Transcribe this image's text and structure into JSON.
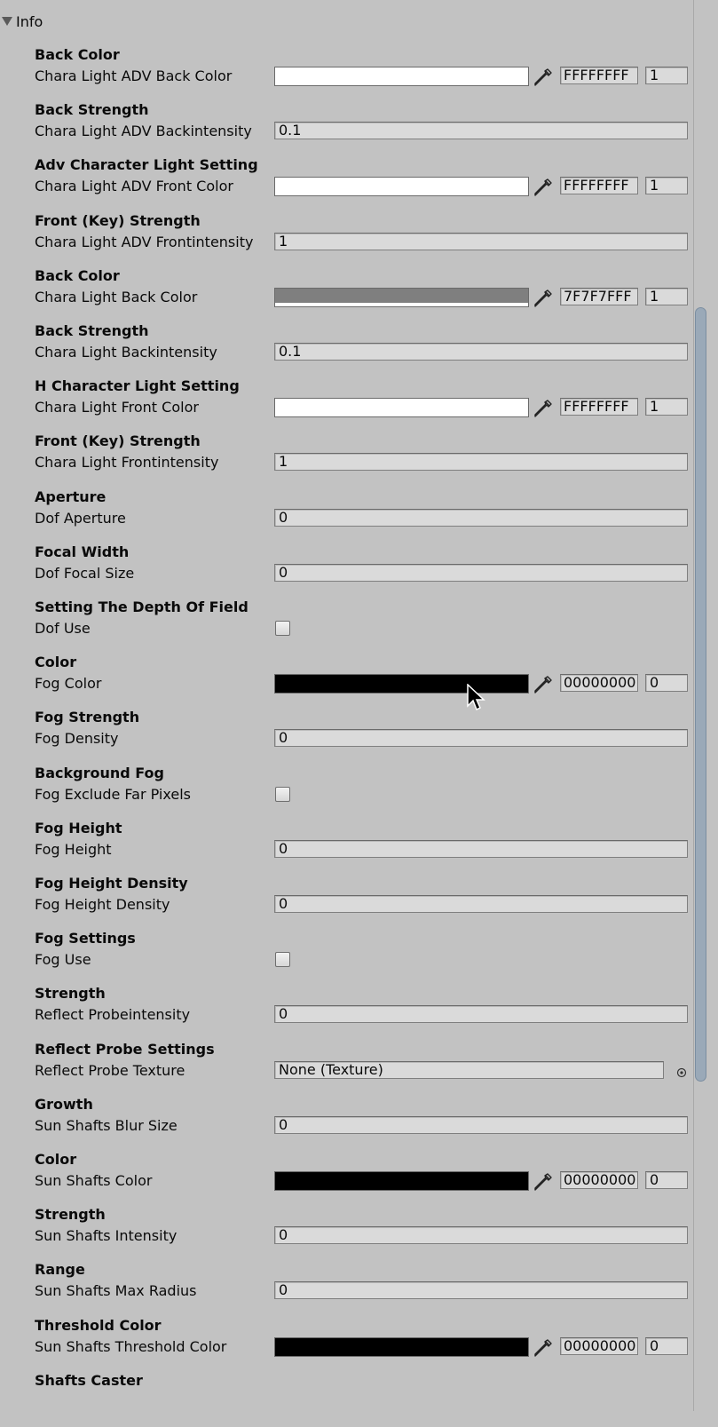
{
  "foldout": {
    "label": "Info"
  },
  "colors": {
    "background": "#c2c2c2",
    "field": "#dadada",
    "scrollbar": "#9aa9b8"
  },
  "properties": [
    {
      "header": "Back Color",
      "name": "Chara Light ADV Back Color",
      "type": "color",
      "swatch": "#ffffff",
      "alpha_bar": true,
      "hex": "FFFFFFFF",
      "alpha": "1"
    },
    {
      "header": "Back Strength",
      "name": "Chara Light ADV Backintensity",
      "type": "text",
      "value": "0.1"
    },
    {
      "header": "Adv Character Light Setting",
      "name": "Chara Light ADV Front Color",
      "type": "color",
      "swatch": "#ffffff",
      "alpha_bar": true,
      "hex": "FFFFFFFF",
      "alpha": "1"
    },
    {
      "header": "Front (Key) Strength",
      "name": "Chara Light ADV Frontintensity",
      "type": "text",
      "value": "1"
    },
    {
      "header": "Back Color",
      "name": "Chara Light Back Color",
      "type": "color",
      "swatch": "#7f7f7f",
      "alpha_bar": true,
      "hex": "7F7F7FFF",
      "alpha": "1"
    },
    {
      "header": "Back Strength",
      "name": "Chara Light Backintensity",
      "type": "text",
      "value": "0.1"
    },
    {
      "header": "H Character Light Setting",
      "name": "Chara Light Front Color",
      "type": "color",
      "swatch": "#ffffff",
      "alpha_bar": true,
      "hex": "FFFFFFFF",
      "alpha": "1"
    },
    {
      "header": "Front (Key) Strength",
      "name": "Chara Light Frontintensity",
      "type": "text",
      "value": "1"
    },
    {
      "header": "Aperture",
      "name": "Dof Aperture",
      "type": "text",
      "value": "0"
    },
    {
      "header": "Focal Width",
      "name": "Dof Focal Size",
      "type": "text",
      "value": "0"
    },
    {
      "header": "Setting The Depth Of Field",
      "name": "Dof Use",
      "type": "checkbox",
      "checked": false
    },
    {
      "header": "Color",
      "name": "Fog Color",
      "type": "color",
      "swatch": "#000000",
      "alpha_bar": false,
      "hex": "00000000",
      "alpha": "0"
    },
    {
      "header": "Fog Strength",
      "name": "Fog Density",
      "type": "text",
      "value": "0"
    },
    {
      "header": "Background Fog",
      "name": "Fog Exclude Far Pixels",
      "type": "checkbox",
      "checked": false
    },
    {
      "header": "Fog Height",
      "name": "Fog Height",
      "type": "text",
      "value": "0"
    },
    {
      "header": "Fog Height Density",
      "name": "Fog Height Density",
      "type": "text",
      "value": "0"
    },
    {
      "header": "Fog Settings",
      "name": "Fog Use",
      "type": "checkbox",
      "checked": false
    },
    {
      "header": "Strength",
      "name": "Reflect Probeintensity",
      "type": "text",
      "value": "0"
    },
    {
      "header": "Reflect Probe Settings",
      "name": "Reflect Probe Texture",
      "type": "object",
      "value": "None (Texture)"
    },
    {
      "header": "Growth",
      "name": "Sun Shafts Blur Size",
      "type": "text",
      "value": "0"
    },
    {
      "header": "Color",
      "name": "Sun Shafts Color",
      "type": "color",
      "swatch": "#000000",
      "alpha_bar": false,
      "hex": "00000000",
      "alpha": "0"
    },
    {
      "header": "Strength",
      "name": "Sun Shafts Intensity",
      "type": "text",
      "value": "0"
    },
    {
      "header": "Range",
      "name": "Sun Shafts Max Radius",
      "type": "text",
      "value": "0"
    },
    {
      "header": "Threshold Color",
      "name": "Sun Shafts Threshold Color",
      "type": "color",
      "swatch": "#000000",
      "alpha_bar": false,
      "hex": "00000000",
      "alpha": "0"
    },
    {
      "header": "Shafts Caster",
      "name": "",
      "type": "header-only"
    }
  ]
}
